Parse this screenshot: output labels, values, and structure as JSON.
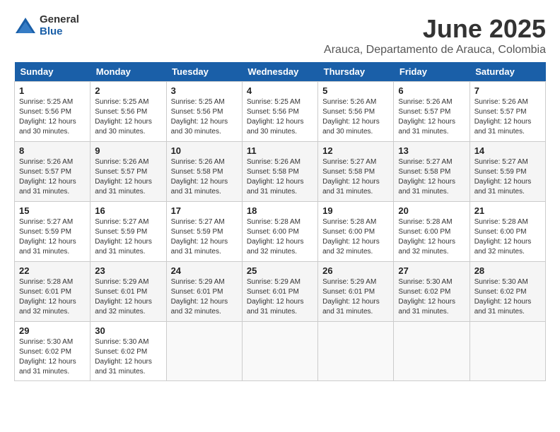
{
  "logo": {
    "general": "General",
    "blue": "Blue"
  },
  "title": {
    "month": "June 2025",
    "location": "Arauca, Departamento de Arauca, Colombia"
  },
  "headers": [
    "Sunday",
    "Monday",
    "Tuesday",
    "Wednesday",
    "Thursday",
    "Friday",
    "Saturday"
  ],
  "weeks": [
    [
      {
        "day": "1",
        "sunrise": "5:25 AM",
        "sunset": "5:56 PM",
        "daylight": "12 hours and 30 minutes."
      },
      {
        "day": "2",
        "sunrise": "5:25 AM",
        "sunset": "5:56 PM",
        "daylight": "12 hours and 30 minutes."
      },
      {
        "day": "3",
        "sunrise": "5:25 AM",
        "sunset": "5:56 PM",
        "daylight": "12 hours and 30 minutes."
      },
      {
        "day": "4",
        "sunrise": "5:25 AM",
        "sunset": "5:56 PM",
        "daylight": "12 hours and 30 minutes."
      },
      {
        "day": "5",
        "sunrise": "5:26 AM",
        "sunset": "5:56 PM",
        "daylight": "12 hours and 30 minutes."
      },
      {
        "day": "6",
        "sunrise": "5:26 AM",
        "sunset": "5:57 PM",
        "daylight": "12 hours and 31 minutes."
      },
      {
        "day": "7",
        "sunrise": "5:26 AM",
        "sunset": "5:57 PM",
        "daylight": "12 hours and 31 minutes."
      }
    ],
    [
      {
        "day": "8",
        "sunrise": "5:26 AM",
        "sunset": "5:57 PM",
        "daylight": "12 hours and 31 minutes."
      },
      {
        "day": "9",
        "sunrise": "5:26 AM",
        "sunset": "5:57 PM",
        "daylight": "12 hours and 31 minutes."
      },
      {
        "day": "10",
        "sunrise": "5:26 AM",
        "sunset": "5:58 PM",
        "daylight": "12 hours and 31 minutes."
      },
      {
        "day": "11",
        "sunrise": "5:26 AM",
        "sunset": "5:58 PM",
        "daylight": "12 hours and 31 minutes."
      },
      {
        "day": "12",
        "sunrise": "5:27 AM",
        "sunset": "5:58 PM",
        "daylight": "12 hours and 31 minutes."
      },
      {
        "day": "13",
        "sunrise": "5:27 AM",
        "sunset": "5:58 PM",
        "daylight": "12 hours and 31 minutes."
      },
      {
        "day": "14",
        "sunrise": "5:27 AM",
        "sunset": "5:59 PM",
        "daylight": "12 hours and 31 minutes."
      }
    ],
    [
      {
        "day": "15",
        "sunrise": "5:27 AM",
        "sunset": "5:59 PM",
        "daylight": "12 hours and 31 minutes."
      },
      {
        "day": "16",
        "sunrise": "5:27 AM",
        "sunset": "5:59 PM",
        "daylight": "12 hours and 31 minutes."
      },
      {
        "day": "17",
        "sunrise": "5:27 AM",
        "sunset": "5:59 PM",
        "daylight": "12 hours and 31 minutes."
      },
      {
        "day": "18",
        "sunrise": "5:28 AM",
        "sunset": "6:00 PM",
        "daylight": "12 hours and 32 minutes."
      },
      {
        "day": "19",
        "sunrise": "5:28 AM",
        "sunset": "6:00 PM",
        "daylight": "12 hours and 32 minutes."
      },
      {
        "day": "20",
        "sunrise": "5:28 AM",
        "sunset": "6:00 PM",
        "daylight": "12 hours and 32 minutes."
      },
      {
        "day": "21",
        "sunrise": "5:28 AM",
        "sunset": "6:00 PM",
        "daylight": "12 hours and 32 minutes."
      }
    ],
    [
      {
        "day": "22",
        "sunrise": "5:28 AM",
        "sunset": "6:01 PM",
        "daylight": "12 hours and 32 minutes."
      },
      {
        "day": "23",
        "sunrise": "5:29 AM",
        "sunset": "6:01 PM",
        "daylight": "12 hours and 32 minutes."
      },
      {
        "day": "24",
        "sunrise": "5:29 AM",
        "sunset": "6:01 PM",
        "daylight": "12 hours and 32 minutes."
      },
      {
        "day": "25",
        "sunrise": "5:29 AM",
        "sunset": "6:01 PM",
        "daylight": "12 hours and 31 minutes."
      },
      {
        "day": "26",
        "sunrise": "5:29 AM",
        "sunset": "6:01 PM",
        "daylight": "12 hours and 31 minutes."
      },
      {
        "day": "27",
        "sunrise": "5:30 AM",
        "sunset": "6:02 PM",
        "daylight": "12 hours and 31 minutes."
      },
      {
        "day": "28",
        "sunrise": "5:30 AM",
        "sunset": "6:02 PM",
        "daylight": "12 hours and 31 minutes."
      }
    ],
    [
      {
        "day": "29",
        "sunrise": "5:30 AM",
        "sunset": "6:02 PM",
        "daylight": "12 hours and 31 minutes."
      },
      {
        "day": "30",
        "sunrise": "5:30 AM",
        "sunset": "6:02 PM",
        "daylight": "12 hours and 31 minutes."
      },
      null,
      null,
      null,
      null,
      null
    ]
  ]
}
